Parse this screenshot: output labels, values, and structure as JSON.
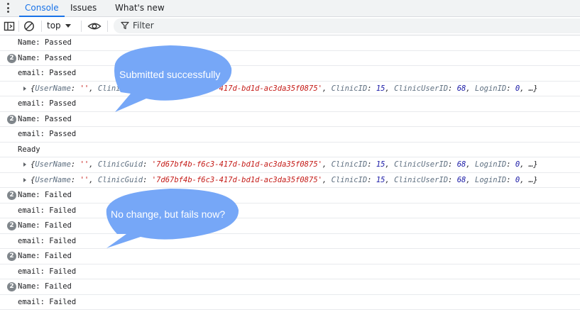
{
  "tabs": [
    {
      "label": "Console",
      "active": true
    },
    {
      "label": "Issues",
      "active": false
    },
    {
      "label": "What's new",
      "active": false
    }
  ],
  "toolbar": {
    "context_label": "top",
    "filter_placeholder": "Filter",
    "icons": [
      "sidebar-toggle-icon",
      "clear-console-icon",
      "chevron-down-icon",
      "eye-icon",
      "filter-icon"
    ]
  },
  "log": [
    {
      "type": "text",
      "text": "Name: Passed"
    },
    {
      "type": "text",
      "text": "Name: Passed",
      "count": "2"
    },
    {
      "type": "text",
      "text": "email: Passed"
    },
    {
      "type": "object",
      "fields": [
        {
          "key": "UserName",
          "value": "''",
          "kind": "string"
        },
        {
          "key": "ClinicGuid",
          "value": "'7d67bf4b-f6c3-417d-bd1d-ac3da35f0875'",
          "kind": "string"
        },
        {
          "key": "ClinicID",
          "value": "15",
          "kind": "number"
        },
        {
          "key": "ClinicUserID",
          "value": "68",
          "kind": "number"
        },
        {
          "key": "LoginID",
          "value": "0",
          "kind": "number"
        }
      ],
      "more": "…}"
    },
    {
      "type": "text",
      "text": "email: Passed"
    },
    {
      "type": "text",
      "text": "Name: Passed",
      "count": "2"
    },
    {
      "type": "text",
      "text": "email: Passed"
    },
    {
      "type": "text",
      "text": "Ready"
    },
    {
      "type": "object",
      "fields": [
        {
          "key": "UserName",
          "value": "''",
          "kind": "string"
        },
        {
          "key": "ClinicGuid",
          "value": "'7d67bf4b-f6c3-417d-bd1d-ac3da35f0875'",
          "kind": "string"
        },
        {
          "key": "ClinicID",
          "value": "15",
          "kind": "number"
        },
        {
          "key": "ClinicUserID",
          "value": "68",
          "kind": "number"
        },
        {
          "key": "LoginID",
          "value": "0",
          "kind": "number"
        }
      ],
      "more": "…}"
    },
    {
      "type": "object",
      "fields": [
        {
          "key": "UserName",
          "value": "''",
          "kind": "string"
        },
        {
          "key": "ClinicGuid",
          "value": "'7d67bf4b-f6c3-417d-bd1d-ac3da35f0875'",
          "kind": "string"
        },
        {
          "key": "ClinicID",
          "value": "15",
          "kind": "number"
        },
        {
          "key": "ClinicUserID",
          "value": "68",
          "kind": "number"
        },
        {
          "key": "LoginID",
          "value": "0",
          "kind": "number"
        }
      ],
      "more": "…}"
    },
    {
      "type": "text",
      "text": "Name: Failed",
      "count": "2"
    },
    {
      "type": "text",
      "text": "email: Failed"
    },
    {
      "type": "text",
      "text": "Name: Failed",
      "count": "2"
    },
    {
      "type": "text",
      "text": "email: Failed"
    },
    {
      "type": "text",
      "text": "Name: Failed",
      "count": "2"
    },
    {
      "type": "text",
      "text": "email: Failed"
    },
    {
      "type": "text",
      "text": "Name: Failed",
      "count": "2"
    },
    {
      "type": "text",
      "text": "email: Failed"
    }
  ],
  "callouts": [
    {
      "text": "Submitted successfully"
    },
    {
      "text": "No change, but fails now?"
    }
  ],
  "colors": {
    "accent": "#1a73e8",
    "callout_fill": "#76a7f7",
    "string_value": "#c41a16",
    "number_value": "#1a1aa6",
    "key": "#5e6f80",
    "badge": "#80868b"
  }
}
